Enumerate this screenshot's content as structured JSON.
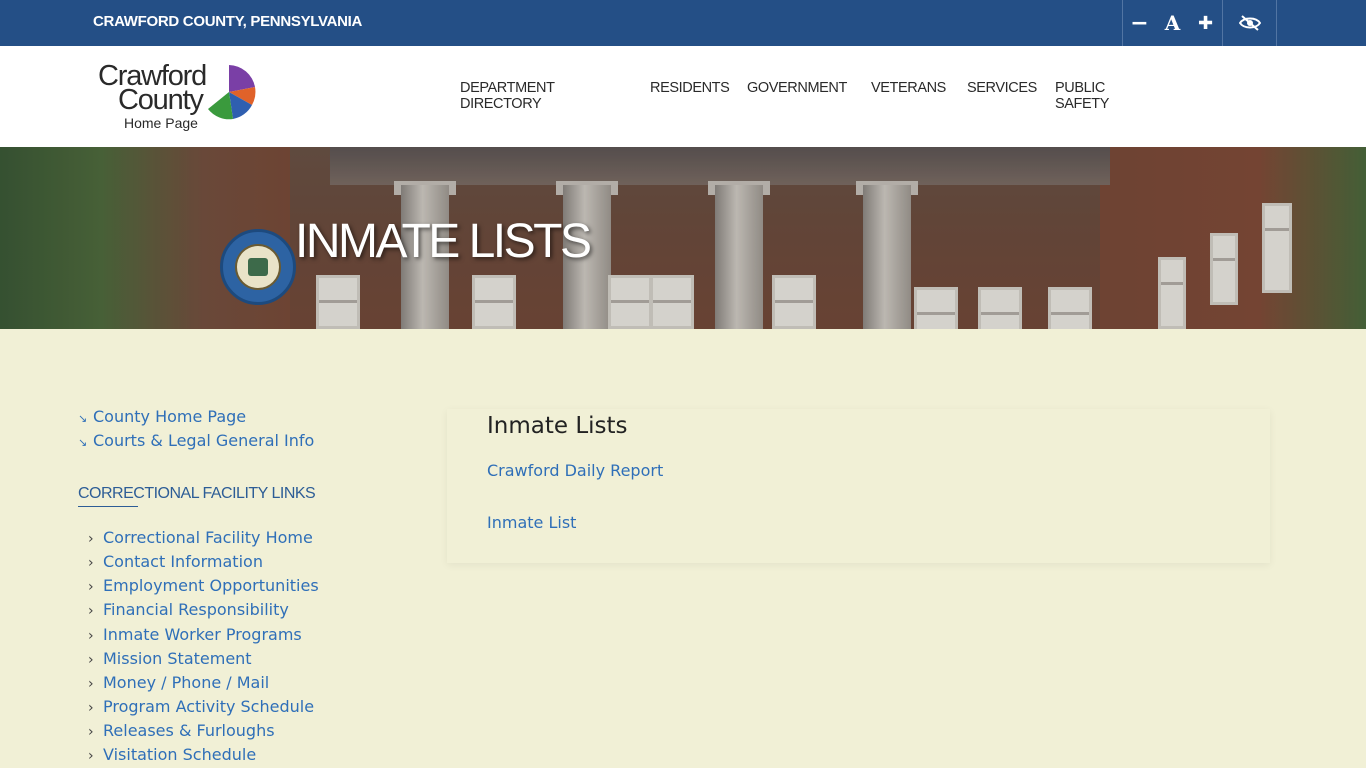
{
  "topbar": {
    "county_label": "CRAWFORD COUNTY, PENNSYLVANIA",
    "tools": {
      "decrease_icon": "minus-icon",
      "decrease": "−",
      "font": "A",
      "increase_icon": "plus-icon",
      "increase": "✚",
      "accessibility_icon": "accessibility-eye-icon"
    }
  },
  "header": {
    "logo": {
      "line1": "Crawford",
      "line2": "County",
      "line3": "Home Page"
    },
    "nav": [
      "DEPARTMENT DIRECTORY",
      "RESIDENTS",
      "GOVERNMENT",
      "VETERANS",
      "SERVICES",
      "PUBLIC SAFETY"
    ]
  },
  "hero": {
    "title": "INMATE LISTS"
  },
  "sidebar": {
    "top_links": [
      "County Home Page",
      "Courts & Legal General Info"
    ],
    "section_title": "CORRECTIONAL FACILITY LINKS",
    "links": [
      "Correctional Facility Home",
      "Contact Information",
      "Employment Opportunities",
      "Financial Responsibility",
      "Inmate Worker Programs",
      "Mission Statement",
      "Money / Phone / Mail",
      "Program Activity Schedule",
      "Releases & Furloughs",
      "Visitation Schedule"
    ]
  },
  "main": {
    "heading": "Inmate Lists",
    "links": [
      "Crawford Daily Report",
      "Inmate List"
    ]
  },
  "colors": {
    "topbar": "#244f86",
    "page_bg": "#f1f0d6",
    "link": "#2f6fb8"
  }
}
